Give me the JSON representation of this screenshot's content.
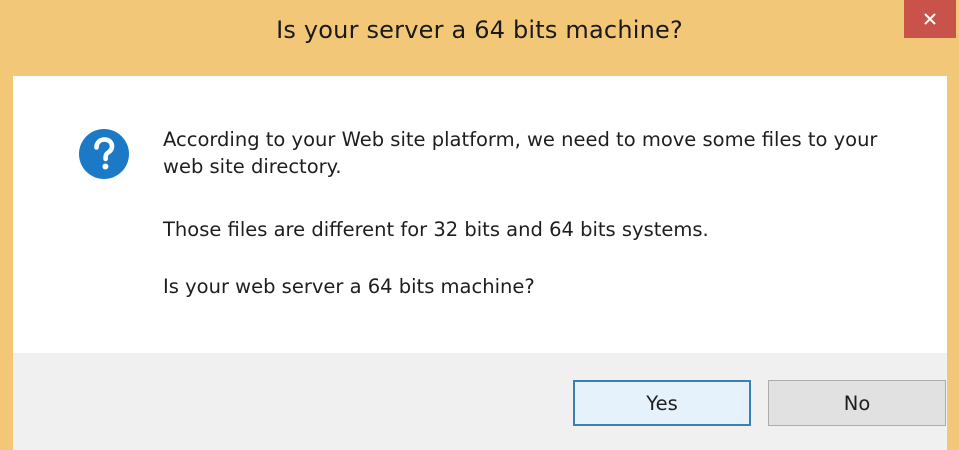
{
  "window": {
    "title": "Is your server a 64 bits machine?",
    "title_bar_color": "#f2c878",
    "close_icon": "close-icon"
  },
  "dialog": {
    "icon": "question-icon",
    "icon_color": "#1c79c6",
    "message_line1": "According to your Web site platform, we need to move some files to your web site directory.",
    "message_line2": "Those files are different for 32 bits and 64 bits systems.",
    "message_line3": "Is your web server a 64 bits machine?"
  },
  "buttons": {
    "yes_label": "Yes",
    "no_label": "No"
  }
}
